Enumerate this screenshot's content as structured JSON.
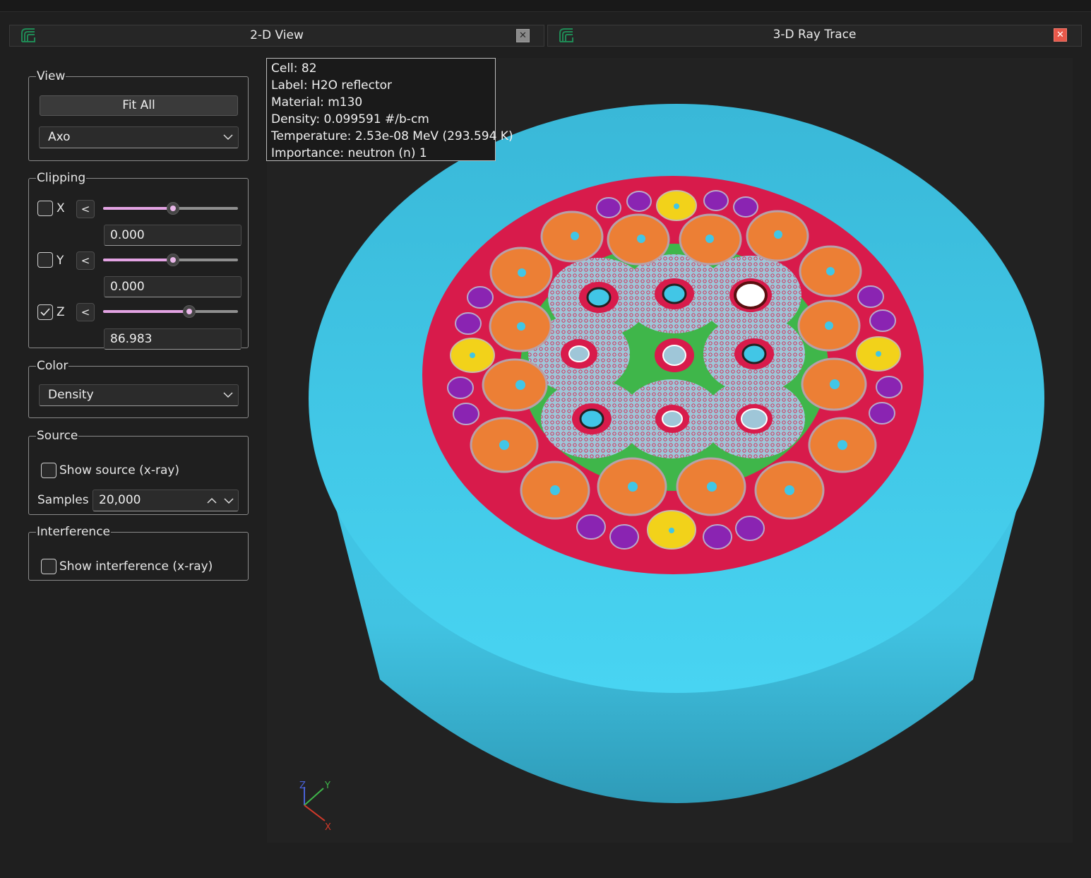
{
  "window": {
    "tabs": [
      {
        "title": "2-D View",
        "close_icon": "close-icon"
      },
      {
        "title": "3-D Ray Trace",
        "close_icon": "close-icon"
      }
    ]
  },
  "panel": {
    "view": {
      "legend": "View",
      "fit_all_label": "Fit All",
      "projection_value": "Axo"
    },
    "clipping": {
      "legend": "Clipping",
      "x": {
        "label": "X",
        "checked": false,
        "direction": "<",
        "value": "0.000",
        "slider_fraction": 0.5
      },
      "y": {
        "label": "Y",
        "checked": false,
        "direction": "<",
        "value": "0.000",
        "slider_fraction": 0.5
      },
      "z": {
        "label": "Z",
        "checked": true,
        "direction": "<",
        "value": "86.983",
        "slider_fraction": 0.63
      }
    },
    "color": {
      "legend": "Color",
      "mode_value": "Density"
    },
    "source": {
      "legend": "Source",
      "show_source_label": "Show source (x-ray)",
      "samples_label": "Samples",
      "samples_value": "20,000"
    },
    "interference": {
      "legend": "Interference",
      "show_interference_label": "Show interference (x-ray)"
    }
  },
  "tooltip": {
    "cell": "Cell: 82",
    "label": "Label: H2O reflector",
    "material": "Material: m130",
    "density": "Density: 0.099591 #/b-cm",
    "temperature": "Temperature: 2.53e-08 MeV (293.594 K)",
    "importance": "Importance: neutron (n) 1"
  },
  "triad": {
    "z": "Z",
    "y": "Y",
    "x": "X"
  },
  "colors": {
    "reflector": "#41c6e6",
    "core": "#d81b4b",
    "fuel_orange": "#ec7f35",
    "purple": "#8a24b2",
    "yellow": "#f2d21a",
    "green": "#3fb64a",
    "assembly_blue": "#9cc3d6"
  }
}
